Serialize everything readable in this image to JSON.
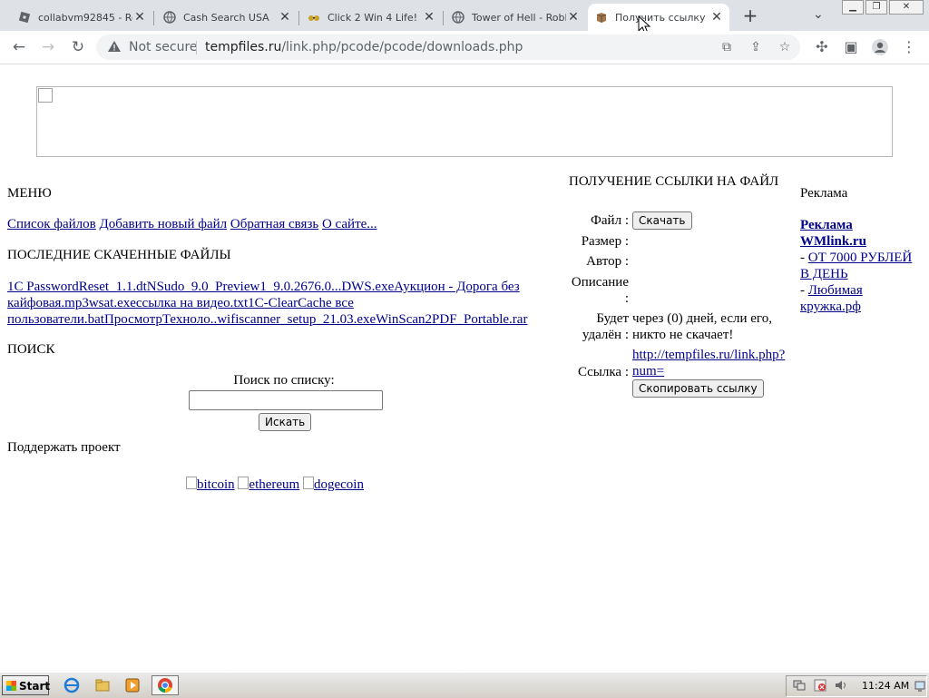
{
  "browser": {
    "tabs": [
      {
        "title": "collabvm92845 - Ro",
        "active": false,
        "favicon": "roblox-icon"
      },
      {
        "title": "Cash Search USA",
        "active": false,
        "favicon": "globe-icon"
      },
      {
        "title": "Click 2 Win 4 Life!",
        "active": false,
        "favicon": "glasses-icon"
      },
      {
        "title": "Tower of Hell - Robl",
        "active": false,
        "favicon": "globe-icon"
      },
      {
        "title": "Получить ссылку н",
        "active": true,
        "favicon": "box-icon"
      }
    ],
    "omnibox": {
      "security_label": "Not secure",
      "url_host": "tempfiles.ru",
      "url_path": "/link.php/pcode/pcode/downloads.php"
    }
  },
  "page": {
    "menu": {
      "title": "МЕНЮ",
      "links": [
        "Список файлов",
        "Добавить новый файл",
        "Обратная связь",
        "О сайте..."
      ]
    },
    "recent": {
      "title": "ПОСЛЕДНИЕ СКАЧЕННЫЕ ФАЙЛЫ",
      "line1": "1C PasswordReset_1.1.dtNSudo_9.0_Preview1_9.0.2676.0...DWS.exeАукцион - Дорога без",
      "line2": "кайфовая.mp3wsat.exeссылка на видео.txt1C-ClearCache все",
      "line3": "пользователи.batПросмотрТехноло..wifiscanner_setup_21.03.exeWinScan2PDF_Portable.rar"
    },
    "search": {
      "title": "ПОИСК",
      "label": "Поиск по списку:",
      "value": "",
      "button": "Искать"
    },
    "support": {
      "title": "Поддержать проект",
      "coins": [
        "bitcoin",
        "ethereum",
        "dogecoin"
      ]
    },
    "file": {
      "title": "ПОЛУЧЕНИЕ ССЫЛКИ НА ФАЙЛ",
      "file_label": "Файл :",
      "download_button": "Скачать",
      "size_label": "Размер :",
      "author_label": "Автор :",
      "desc_label_1": "Описание",
      "desc_label_2": ":",
      "delete_label_1": "Будет",
      "delete_label_2": "удалён :",
      "delete_value_1": "через (0) дней, если его,",
      "delete_value_2": "никто не скачает!",
      "link_label": "Ссылка :",
      "link_1": "http://tempfiles.ru/link.php?",
      "link_2": "num=",
      "copy_button": "Скопировать ссылку"
    },
    "ads": {
      "title": "Реклама",
      "wmlink_1": "Реклама",
      "wmlink_2": "WMlink.ru",
      "ad1_dash": "-",
      "ad1_1": "ОТ 7000 РУБЛЕЙ",
      "ad1_2": "В ДЕНЬ",
      "ad2_dash": "-",
      "ad2_1": "Любимая",
      "ad2_2": "кружка.рф"
    }
  },
  "taskbar": {
    "start": "Start",
    "clock": "11:24 AM"
  }
}
